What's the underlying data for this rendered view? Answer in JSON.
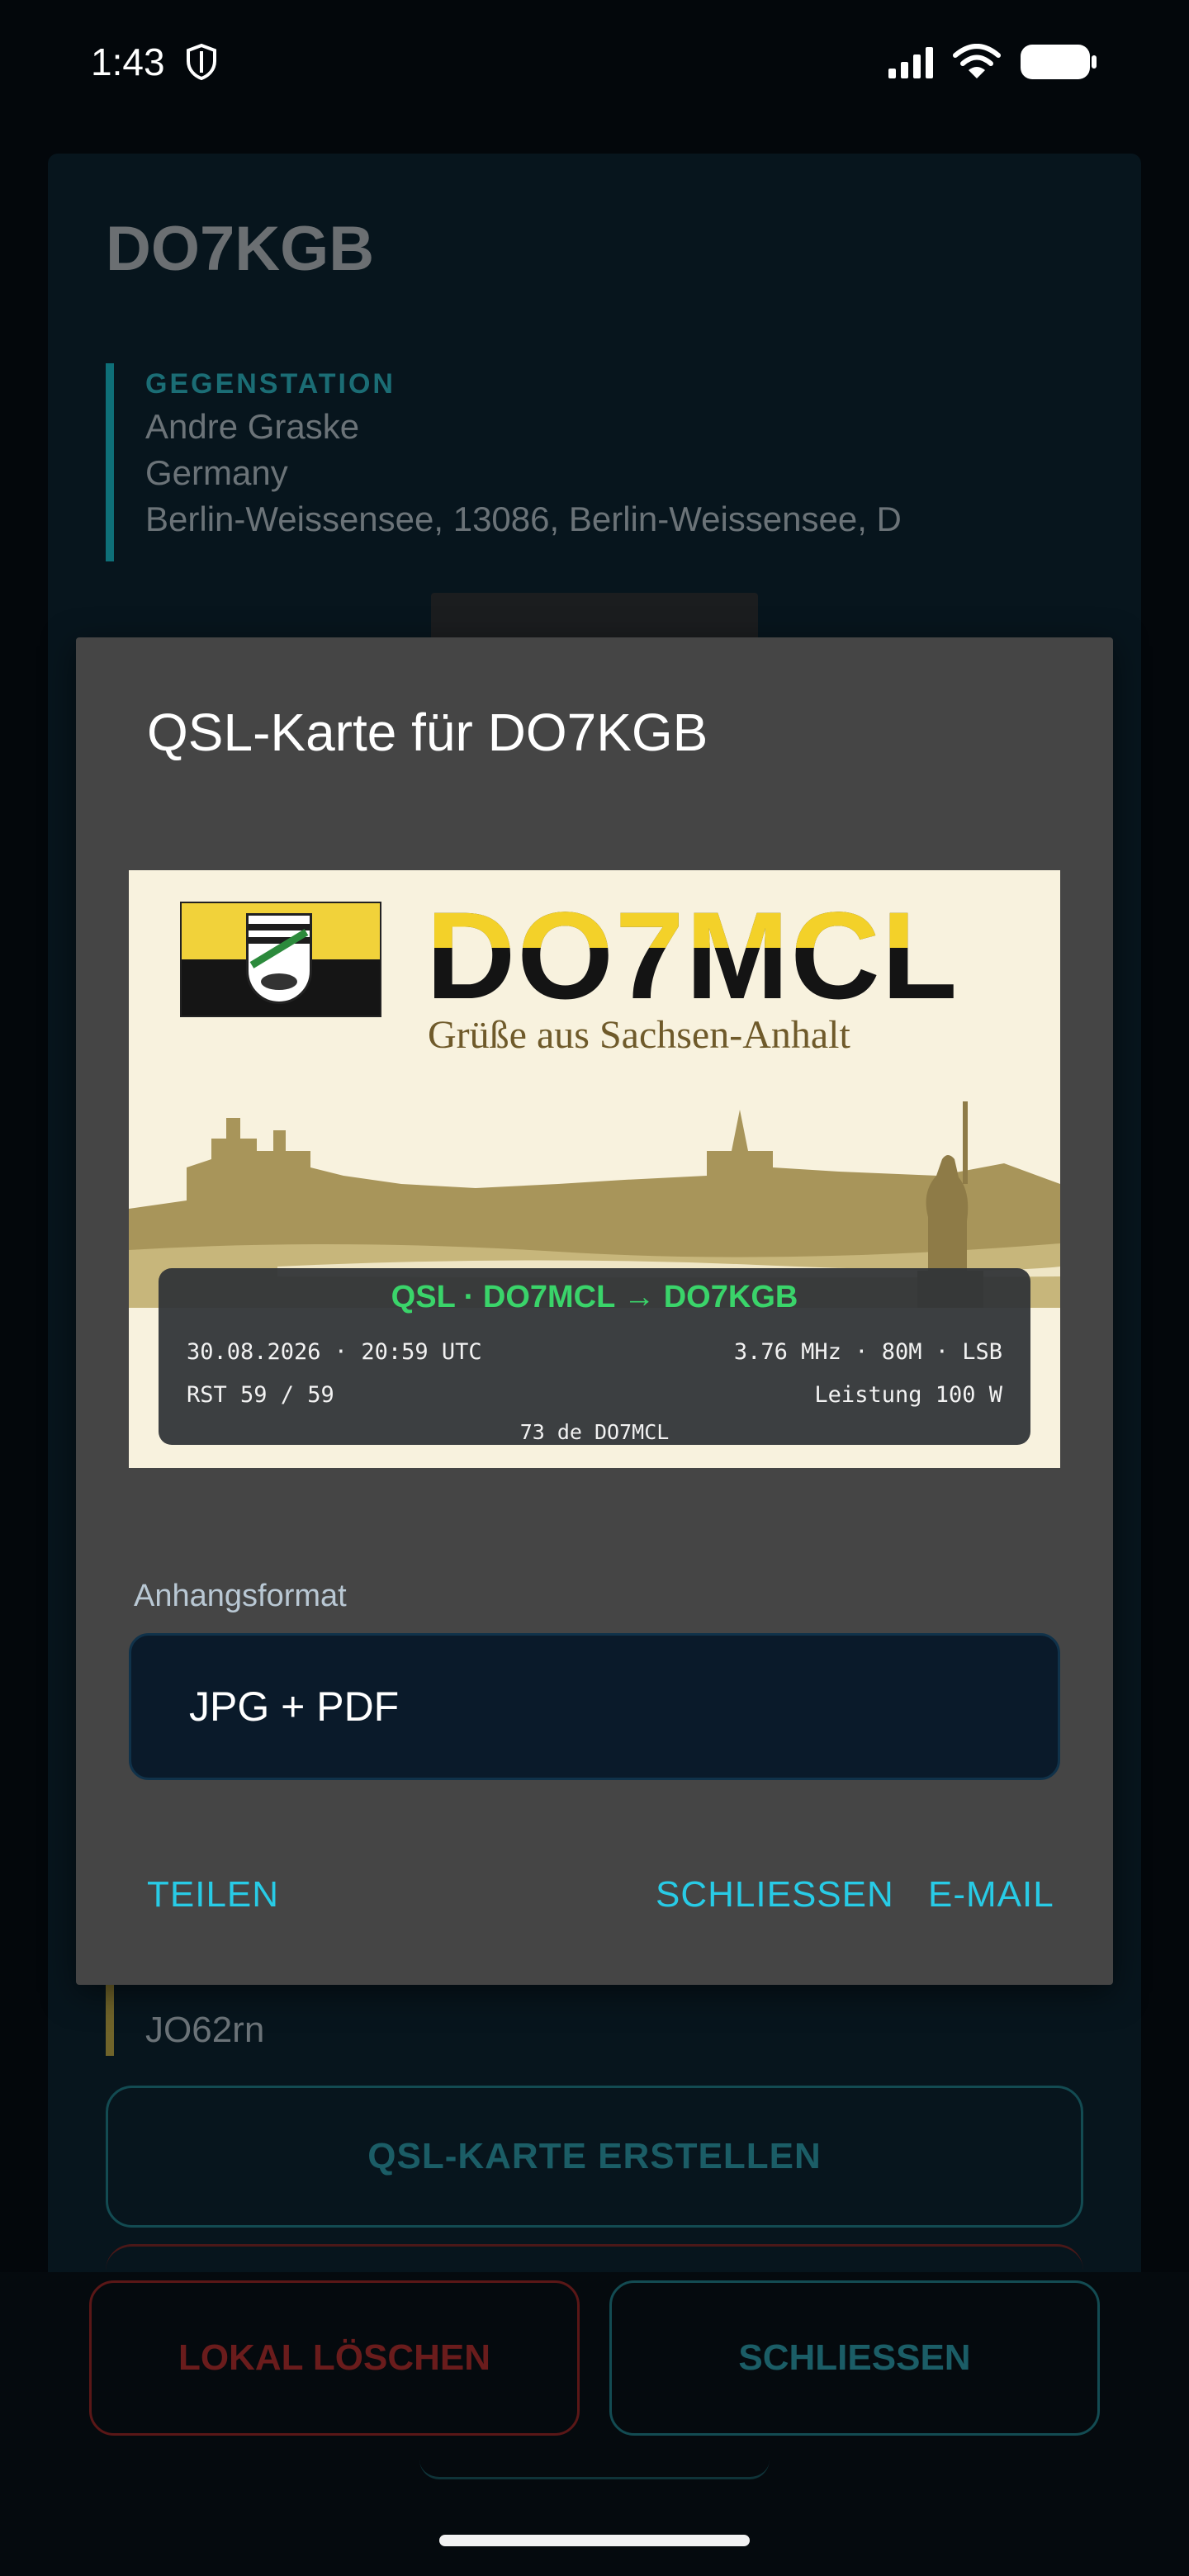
{
  "status_bar": {
    "time": "1:43"
  },
  "background": {
    "callsign": "DO7KGB",
    "gegenstation": {
      "label": "GEGENSTATION",
      "name": "Andre  Graske",
      "country": "Germany",
      "address": "Berlin-Weissensee, 13086, Berlin-Weissensee, D"
    },
    "locator": "JO62rn",
    "qsl_create_label": "QSL-KARTE ERSTELLEN",
    "delete_label": "LOKAL LÖSCHEN",
    "close_label": "SCHLIESSEN"
  },
  "dialog": {
    "title": "QSL-Karte für DO7KGB",
    "card": {
      "callsign": "DO7MCL",
      "subtitle": "Grüße aus Sachsen-Anhalt",
      "qso_title": "QSL · DO7MCL → DO7KGB",
      "datetime": "30.08.2026 · 20:59 UTC",
      "freq": "3.76 MHz · 80M · LSB",
      "rst": "RST 59 / 59",
      "power": "Leistung 100 W",
      "greeting": "73 de DO7MCL"
    },
    "format_label": "Anhangsformat",
    "format_value": "JPG + PDF",
    "share_label": "TEILEN",
    "close_label": "SCHLIESSEN",
    "email_label": "E-MAIL"
  },
  "colors": {
    "accent": "#28cbe6",
    "qso_green": "#3ad46a",
    "danger": "#6a1c1c"
  }
}
